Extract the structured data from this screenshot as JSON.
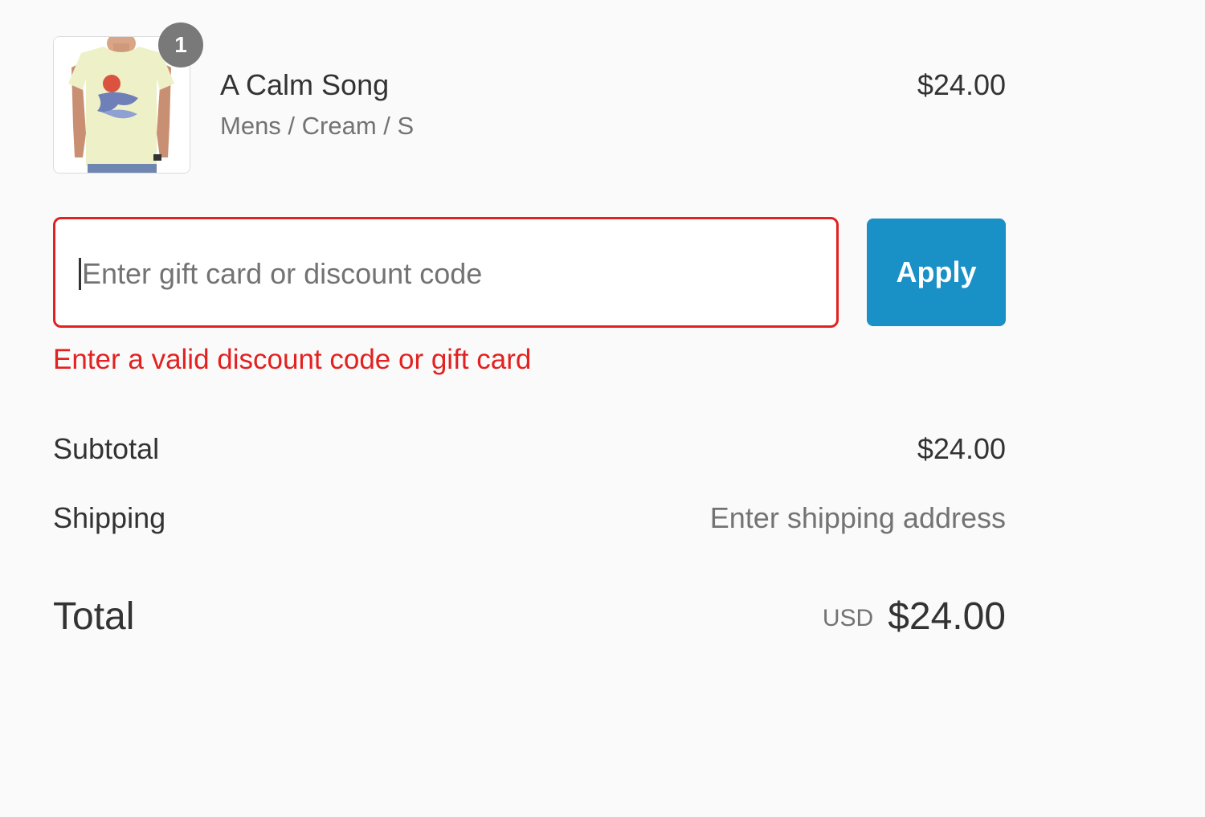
{
  "line_item": {
    "quantity": "1",
    "title": "A Calm Song",
    "variant": "Mens / Cream / S",
    "price": "$24.00",
    "image_icon": "tshirt-product-image"
  },
  "discount": {
    "placeholder": "Enter gift card or discount code",
    "value": "",
    "apply_label": "Apply",
    "error": "Enter a valid discount code or gift card"
  },
  "totals": {
    "subtotal_label": "Subtotal",
    "subtotal_value": "$24.00",
    "shipping_label": "Shipping",
    "shipping_value": "Enter shipping address",
    "total_label": "Total",
    "currency": "USD",
    "total_value": "$24.00"
  },
  "colors": {
    "error": "#e22120",
    "button": "#1990c6",
    "badge": "#727272",
    "muted_text": "#737373"
  }
}
